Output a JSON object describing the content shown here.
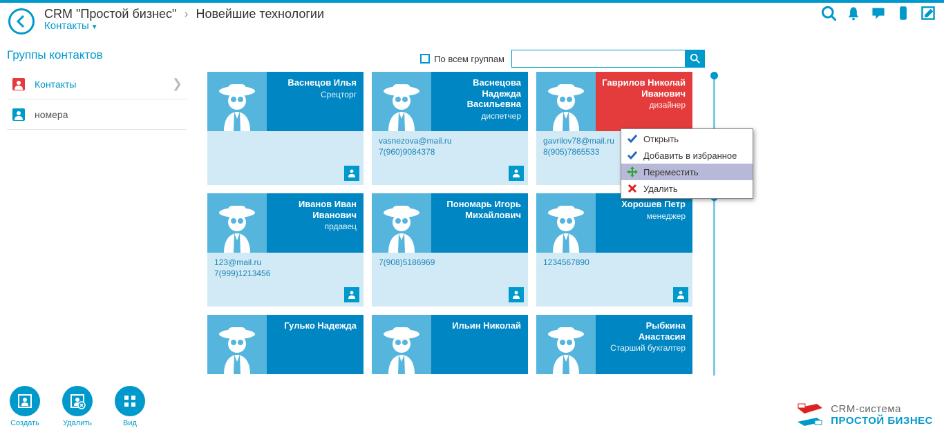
{
  "breadcrumb": {
    "root": "CRM \"Простой бизнес\"",
    "current": "Новейшие технологии",
    "sub": "Контакты"
  },
  "sidebar": {
    "title": "Группы контактов",
    "items": [
      {
        "label": "Контакты",
        "active": true,
        "red": true
      },
      {
        "label": "номера",
        "active": false,
        "red": false
      }
    ]
  },
  "search": {
    "allgroups_label": "По всем группам",
    "placeholder": ""
  },
  "contacts": [
    {
      "name": "Васнецов Илья",
      "role": "Срецторг",
      "email": "",
      "phone": "",
      "selected": false
    },
    {
      "name": "Васнецова Надежда Васильевна",
      "role": "диспетчер",
      "email": "vasnezova@mail.ru",
      "phone": "7(960)9084378",
      "selected": false
    },
    {
      "name": "Гаврилов Николай Иванович",
      "role": "дизайнер",
      "email": "gavrilov78@mail.ru",
      "phone": "8(905)7865533",
      "selected": true
    },
    {
      "name": "Иванов Иван Иванович",
      "role": "прдавец",
      "email": "123@mail.ru",
      "phone": "7(999)1213456",
      "selected": false
    },
    {
      "name": "Пономарь Игорь Михайлович",
      "role": "",
      "email": "7(908)5186969",
      "phone": "",
      "selected": false
    },
    {
      "name": "Хорошев Петр",
      "role": "менеджер",
      "email": "1234567890",
      "phone": "",
      "selected": false
    },
    {
      "name": "Гулько Надежда",
      "role": "",
      "email": "",
      "phone": "",
      "short": true
    },
    {
      "name": "Ильин Николай",
      "role": "",
      "email": "",
      "phone": "",
      "short": true
    },
    {
      "name": "Рыбкина Анастасия",
      "role": "Старший бухгалтер",
      "email": "",
      "phone": "",
      "short": true
    }
  ],
  "context_menu": {
    "items": [
      {
        "label": "Открыть",
        "icon": "check"
      },
      {
        "label": "Добавить в избранное",
        "icon": "check"
      },
      {
        "label": "Переместить",
        "icon": "move",
        "hover": true
      },
      {
        "label": "Удалить",
        "icon": "del"
      }
    ]
  },
  "footer": {
    "create": "Создать",
    "delete": "Удалить",
    "view": "Вид"
  },
  "brand": {
    "line1": "CRM-система",
    "line2": "ПРОСТОЙ БИЗНЕС"
  }
}
